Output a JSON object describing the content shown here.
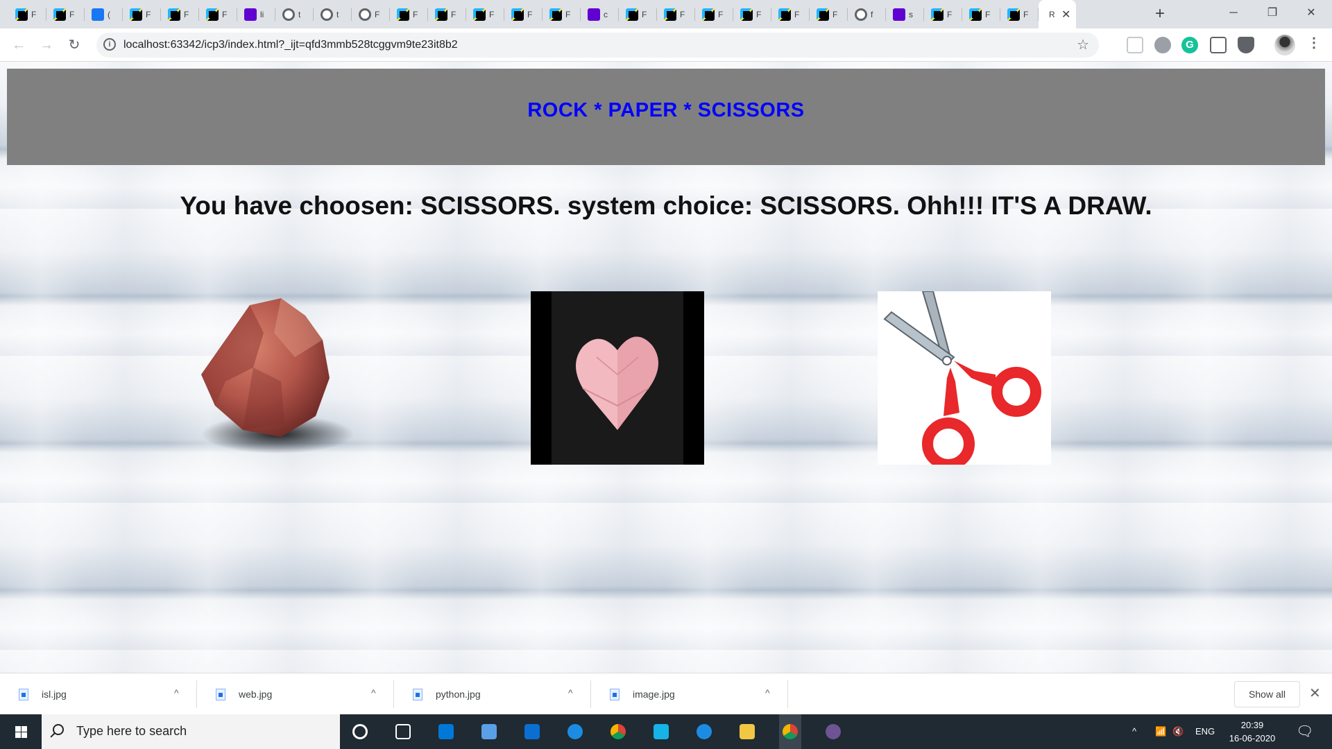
{
  "browser": {
    "tabs": [
      {
        "favicon": "webstorm-icon",
        "title": "F"
      },
      {
        "favicon": "webstorm-icon",
        "title": "F"
      },
      {
        "favicon": "facebook-icon",
        "title": "("
      },
      {
        "favicon": "webstorm-icon",
        "title": "F"
      },
      {
        "favicon": "webstorm-icon",
        "title": "F"
      },
      {
        "favicon": "webstorm-icon",
        "title": "F"
      },
      {
        "favicon": "yahoo-icon",
        "title": "li"
      },
      {
        "favicon": "globe-icon",
        "title": "t"
      },
      {
        "favicon": "globe-icon",
        "title": "t"
      },
      {
        "favicon": "globe-icon",
        "title": "F"
      },
      {
        "favicon": "webstorm-icon",
        "title": "F"
      },
      {
        "favicon": "webstorm-icon",
        "title": "F"
      },
      {
        "favicon": "webstorm-icon",
        "title": "F"
      },
      {
        "favicon": "webstorm-icon",
        "title": "F"
      },
      {
        "favicon": "webstorm-icon",
        "title": "F"
      },
      {
        "favicon": "yahoo-icon",
        "title": "c"
      },
      {
        "favicon": "webstorm-icon",
        "title": "F"
      },
      {
        "favicon": "webstorm-icon",
        "title": "F"
      },
      {
        "favicon": "webstorm-icon",
        "title": "F"
      },
      {
        "favicon": "webstorm-icon",
        "title": "F"
      },
      {
        "favicon": "webstorm-icon",
        "title": "F"
      },
      {
        "favicon": "webstorm-icon",
        "title": "F"
      },
      {
        "favicon": "globe-icon",
        "title": "f"
      },
      {
        "favicon": "yahoo-icon",
        "title": "s"
      },
      {
        "favicon": "webstorm-icon",
        "title": "F"
      },
      {
        "favicon": "webstorm-icon",
        "title": "F"
      },
      {
        "favicon": "webstorm-icon",
        "title": "F"
      }
    ],
    "active_tab": {
      "title": "R",
      "close": "✕"
    },
    "new_tab": "+",
    "window_controls": {
      "minimize": "─",
      "restore": "❐",
      "close": "✕"
    },
    "nav": {
      "back": "←",
      "forward": "→",
      "reload": "↻"
    },
    "url": "localhost:63342/icp3/index.html?_ijt=qfd3mmb528tcggvm9te23it8b2",
    "info_glyph": "i",
    "star": "☆",
    "extension_label": "G",
    "menu": "⋮"
  },
  "page": {
    "title": "ROCK * PAPER * SCISSORS",
    "result": "You have choosen: SCISSORS. system choice: SCISSORS. Ohh!!! IT'S A DRAW.",
    "choices": [
      {
        "name": "rock",
        "image": "rock-image"
      },
      {
        "name": "paper",
        "image": "paper-heart-image"
      },
      {
        "name": "scissors",
        "image": "scissors-image"
      }
    ],
    "colors": {
      "banner_bg": "#808080",
      "title_color": "#0000ff"
    }
  },
  "downloads": {
    "items": [
      {
        "name": "isl.jpg",
        "caret": "^"
      },
      {
        "name": "web.jpg",
        "caret": "^"
      },
      {
        "name": "python.jpg",
        "caret": "^"
      },
      {
        "name": "image.jpg",
        "caret": "^"
      }
    ],
    "show_all": "Show all",
    "close": "✕"
  },
  "taskbar": {
    "search_placeholder": "Type here to search",
    "apps": [
      "cortana-icon",
      "task-view-icon",
      "store-icon",
      "remote-desktop-icon",
      "mail-icon",
      "edge-icon",
      "chrome-icon",
      "webstorm-icon",
      "ie-icon",
      "file-explorer-icon",
      "chrome-icon",
      "github-icon"
    ],
    "tray": {
      "chevron": "^",
      "language": "ENG"
    },
    "time": "20:39",
    "date": "16-06-2020"
  }
}
